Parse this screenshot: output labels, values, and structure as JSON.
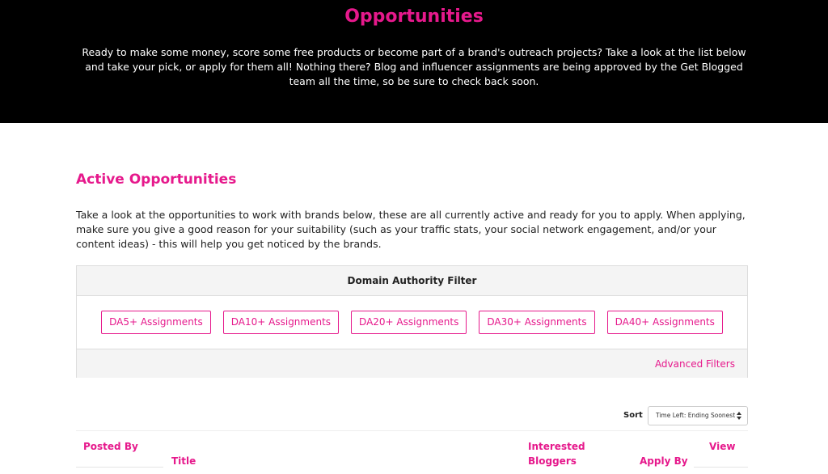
{
  "hero": {
    "title": "Opportunities",
    "text": "Ready to make some money, score some free products or become part of a brand's outreach projects? Take a look at the list below and take your pick, or apply for them all! Nothing there? Blog and influencer assignments are being approved by the Get Blogged team all the time, so be sure to check back soon."
  },
  "active": {
    "title": "Active Opportunities",
    "intro": "Take a look at the opportunities to work with brands below, these are all currently active and ready for you to apply. When applying, make sure you give a good reason for your suitability (such as your traffic stats, your social network engagement, and/or your content ideas) - this will help you get noticed by the brands."
  },
  "filter": {
    "heading": "Domain Authority Filter",
    "buttons": [
      "DA5+ Assignments",
      "DA10+ Assignments",
      "DA20+ Assignments",
      "DA30+ Assignments",
      "DA40+ Assignments"
    ],
    "advanced_label": "Advanced Filters"
  },
  "sort": {
    "label": "Sort",
    "selected": "Time Left: Ending Soonest"
  },
  "table": {
    "columns": {
      "posted_by": "Posted By",
      "title": "Title",
      "interested": "Interested Bloggers",
      "apply_by": "Apply By",
      "view": "View"
    }
  },
  "colors": {
    "accent": "#e6198c",
    "hero_bg": "#000000",
    "panel_bg": "#f4f4f4"
  },
  "icons": {
    "sort_select": "chevron-updown-icon"
  }
}
